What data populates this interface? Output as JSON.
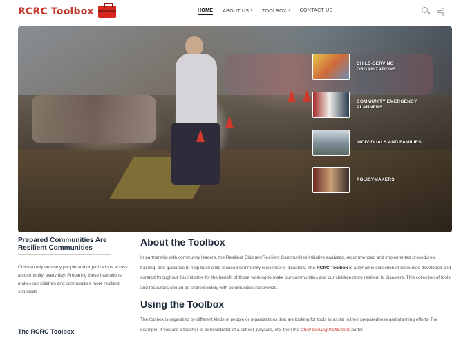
{
  "header": {
    "logo_text": "RCRC Toolbox",
    "nav": [
      {
        "label": "HOME",
        "active": true
      },
      {
        "label": "ABOUT US",
        "active": false
      },
      {
        "label": "TOOLBOX",
        "active": false
      },
      {
        "label": "CONTACT US",
        "active": false
      }
    ],
    "icons": [
      "search-icon",
      "share-icon"
    ]
  },
  "hero": {
    "tiles": [
      {
        "label": "CHILD-SERVING ORGANIZATIONS"
      },
      {
        "label": "COMMUNITY EMERGENCY PLANNERS"
      },
      {
        "label": "INDIVIDUALS AND FAMILIES"
      },
      {
        "label": "POLICYMAKERS"
      }
    ]
  },
  "sidebar": {
    "title": "Prepared Communities Are Resilient Communities",
    "body": "Children rely on many people and organizations across a community, every day. Preparing these institutions makes our children and communities more resilient. #safekids",
    "subheading": "The RCRC Toolbox"
  },
  "main": {
    "about_heading": "About the Toolbox",
    "about_text_1": "In partnership with community leaders, the Resilient Children/Resilient Communities Initiative analyzed, recommended and implemented procedures, training, and guidance to help build child-focused community resilience to disasters. The ",
    "about_bold": "RCRC Toolbox",
    "about_text_2": " is a dynamic collection of resources developed and curated throughout this initiative for the benefit of those working to make our communities and our children more resilient to disasters. This collection of tools and resources should be shared widely with communities nationwide.",
    "using_heading": "Using the Toolbox",
    "using_text_1": "The toolbox is organized by different kinds of people or organizations that are looking for tools to assist in their preparedness and planning efforts. For example, if you are a teacher or administrator of a school, daycare, etc. then the ",
    "using_link": "Child Serving Institutions",
    "using_text_2": " portal"
  },
  "colors": {
    "brand_red": "#c0392b",
    "heading_navy": "#1c2a3a"
  }
}
